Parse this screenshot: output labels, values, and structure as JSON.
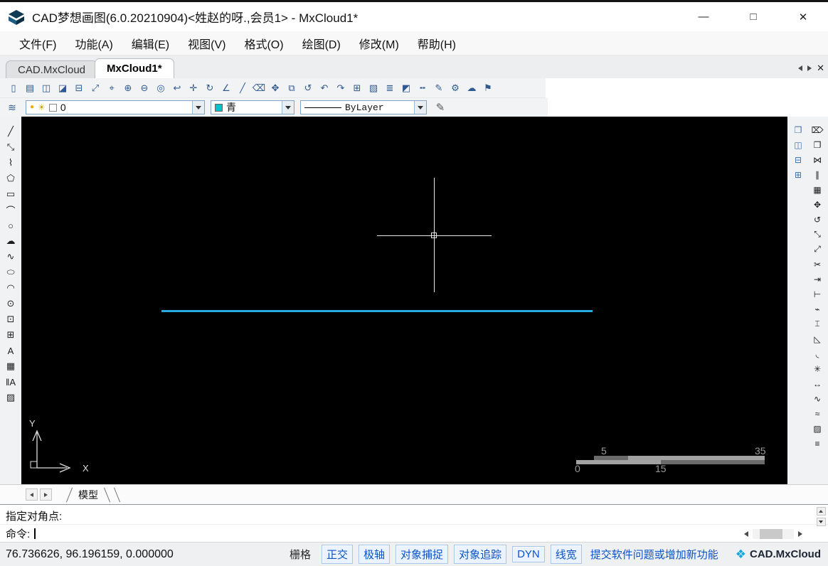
{
  "window": {
    "title": "CAD梦想画图(6.0.20210904)<姓赵的呀.,会员1> - MxCloud1*",
    "minimize_label": "—",
    "maximize_label": "□",
    "close_label": "✕"
  },
  "menu_bar": {
    "items": [
      {
        "name": "menu-file",
        "label": "文件(F)"
      },
      {
        "name": "menu-function",
        "label": "功能(A)"
      },
      {
        "name": "menu-edit",
        "label": "编辑(E)"
      },
      {
        "name": "menu-view",
        "label": "视图(V)"
      },
      {
        "name": "menu-format",
        "label": "格式(O)"
      },
      {
        "name": "menu-draw",
        "label": "绘图(D)"
      },
      {
        "name": "menu-modify",
        "label": "修改(M)"
      },
      {
        "name": "menu-help",
        "label": "帮助(H)"
      }
    ]
  },
  "doc_tabs": {
    "tabs": [
      {
        "name": "tab-cad-mxcloud",
        "label": "CAD.MxCloud",
        "active": false
      },
      {
        "name": "tab-mxcloud1",
        "label": "MxCloud1*",
        "active": true
      }
    ],
    "close_label": "✕"
  },
  "toolbar": {
    "buttons": [
      {
        "name": "new-file-button",
        "glyph": "▯"
      },
      {
        "name": "open-file-button",
        "glyph": "▤"
      },
      {
        "name": "save-file-button",
        "glyph": "◫"
      },
      {
        "name": "save-as-button",
        "glyph": "◪"
      },
      {
        "name": "print-button",
        "glyph": "⊟"
      },
      {
        "name": "zoom-extents-button",
        "glyph": "⤢"
      },
      {
        "name": "zoom-window-button",
        "glyph": "⌖"
      },
      {
        "name": "zoom-in-button",
        "glyph": "⊕"
      },
      {
        "name": "zoom-out-button",
        "glyph": "⊖"
      },
      {
        "name": "zoom-dynamic-button",
        "glyph": "◎"
      },
      {
        "name": "zoom-previous-button",
        "glyph": "↩"
      },
      {
        "name": "pan-button",
        "glyph": "✛"
      },
      {
        "name": "regen-button",
        "glyph": "↻"
      },
      {
        "name": "measure-button",
        "glyph": "∠"
      },
      {
        "name": "draw-line-button",
        "glyph": "╱"
      },
      {
        "name": "erase-button",
        "glyph": "⌫"
      },
      {
        "name": "move-button",
        "glyph": "✥"
      },
      {
        "name": "copy-button",
        "glyph": "⧉"
      },
      {
        "name": "rotate-button",
        "glyph": "↺"
      },
      {
        "name": "undo-button",
        "glyph": "↶"
      },
      {
        "name": "redo-button",
        "glyph": "↷"
      },
      {
        "name": "insert-block-button",
        "glyph": "⊞"
      },
      {
        "name": "raster-image-button",
        "glyph": "▧"
      },
      {
        "name": "layer-manager-button",
        "glyph": "≣"
      },
      {
        "name": "color-picker-button",
        "glyph": "◩"
      },
      {
        "name": "linetype-button",
        "glyph": "╍"
      },
      {
        "name": "match-properties-button",
        "glyph": "✎"
      },
      {
        "name": "options-button",
        "glyph": "⚙"
      },
      {
        "name": "cloud-save-button",
        "glyph": "☁"
      },
      {
        "name": "feedback-button",
        "glyph": "⚑"
      }
    ]
  },
  "properties_bar": {
    "layers_tool_glyph": "≋",
    "layer": {
      "on_glyph": "●",
      "freeze_glyph": "☀",
      "value": "0"
    },
    "color": {
      "value": "青",
      "swatch_hex": "#00c4cc"
    },
    "linetype": {
      "value": "ByLayer"
    },
    "linewidth_tool_glyph": "✎"
  },
  "draw_toolbar": {
    "buttons": [
      {
        "name": "line-tool",
        "glyph": "╱"
      },
      {
        "name": "construction-line-tool",
        "glyph": "⤡"
      },
      {
        "name": "polyline-tool",
        "glyph": "⌇"
      },
      {
        "name": "polygon-tool",
        "glyph": "⬠"
      },
      {
        "name": "rectangle-tool",
        "glyph": "▭"
      },
      {
        "name": "arc-tool",
        "glyph": "⌒"
      },
      {
        "name": "circle-tool",
        "glyph": "○"
      },
      {
        "name": "revision-cloud-tool",
        "glyph": "☁"
      },
      {
        "name": "spline-tool",
        "glyph": "∿"
      },
      {
        "name": "ellipse-tool",
        "glyph": "⬭"
      },
      {
        "name": "ellipse-arc-tool",
        "glyph": "◠"
      },
      {
        "name": "point-tool",
        "glyph": "⊙"
      },
      {
        "name": "insert-block-tool",
        "glyph": "⊡"
      },
      {
        "name": "make-block-tool",
        "glyph": "⊞"
      },
      {
        "name": "text-tool",
        "glyph": "A"
      },
      {
        "name": "table-tool",
        "glyph": "▦"
      },
      {
        "name": "mtext-tool",
        "glyph": "‖A"
      },
      {
        "name": "hatch-tool",
        "glyph": "▨"
      }
    ]
  },
  "modify_toolbar": {
    "viewport_buttons": [
      {
        "name": "viewport-single-button",
        "glyph": "❐"
      },
      {
        "name": "viewport-two-button",
        "glyph": "◫"
      },
      {
        "name": "viewport-three-button",
        "glyph": "⊟"
      },
      {
        "name": "viewport-four-button",
        "glyph": "⊞"
      }
    ],
    "buttons": [
      {
        "name": "erase-tool",
        "glyph": "⌦"
      },
      {
        "name": "copy-tool",
        "glyph": "❐"
      },
      {
        "name": "mirror-tool",
        "glyph": "⋈"
      },
      {
        "name": "offset-tool",
        "glyph": "∥"
      },
      {
        "name": "array-tool",
        "glyph": "▦"
      },
      {
        "name": "move-tool",
        "glyph": "✥"
      },
      {
        "name": "rotate-tool",
        "glyph": "↺"
      },
      {
        "name": "scale-tool",
        "glyph": "⤡"
      },
      {
        "name": "stretch-tool",
        "glyph": "⤢"
      },
      {
        "name": "trim-tool",
        "glyph": "✂"
      },
      {
        "name": "extend-tool",
        "glyph": "⇥"
      },
      {
        "name": "break-at-point-tool",
        "glyph": "⊢"
      },
      {
        "name": "break-tool",
        "glyph": "⌁"
      },
      {
        "name": "join-tool",
        "glyph": "⌶"
      },
      {
        "name": "chamfer-tool",
        "glyph": "◺"
      },
      {
        "name": "fillet-tool",
        "glyph": "◟"
      },
      {
        "name": "explode-tool",
        "glyph": "✳"
      },
      {
        "name": "lengthen-tool",
        "glyph": "↔"
      },
      {
        "name": "edit-polyline-tool",
        "glyph": "∿"
      },
      {
        "name": "edit-spline-tool",
        "glyph": "≈"
      },
      {
        "name": "edit-hatch-tool",
        "glyph": "▨"
      },
      {
        "name": "properties-tool",
        "glyph": "≡"
      }
    ]
  },
  "canvas": {
    "line_color": "#29abe2",
    "crosshair_color": "#e8e8e8",
    "ucs": {
      "x_label": "X",
      "y_label": "Y"
    },
    "ruler": {
      "top_left": "5",
      "top_right": "35",
      "bottom_left": "0",
      "bottom_mid": "15"
    }
  },
  "model_bar": {
    "tab_label": "模型"
  },
  "command_area": {
    "history_line": "指定对角点:",
    "prompt_label": "命令:"
  },
  "status_bar": {
    "coordinates": "76.736626, 96.196159, 0.000000",
    "toggles": [
      {
        "name": "toggle-grid",
        "label": "栅格",
        "active": false
      },
      {
        "name": "toggle-ortho",
        "label": "正交",
        "active": true
      },
      {
        "name": "toggle-polar",
        "label": "极轴",
        "active": true
      },
      {
        "name": "toggle-osnap",
        "label": "对象捕捉",
        "active": true
      },
      {
        "name": "toggle-otrack",
        "label": "对象追踪",
        "active": true
      },
      {
        "name": "toggle-dyn",
        "label": "DYN",
        "active": true
      },
      {
        "name": "toggle-lineweight",
        "label": "线宽",
        "active": true
      }
    ],
    "feedback_link": "提交软件问题或增加新功能",
    "brand": {
      "logo_glyph": "❖",
      "label": "CAD.MxCloud"
    }
  }
}
